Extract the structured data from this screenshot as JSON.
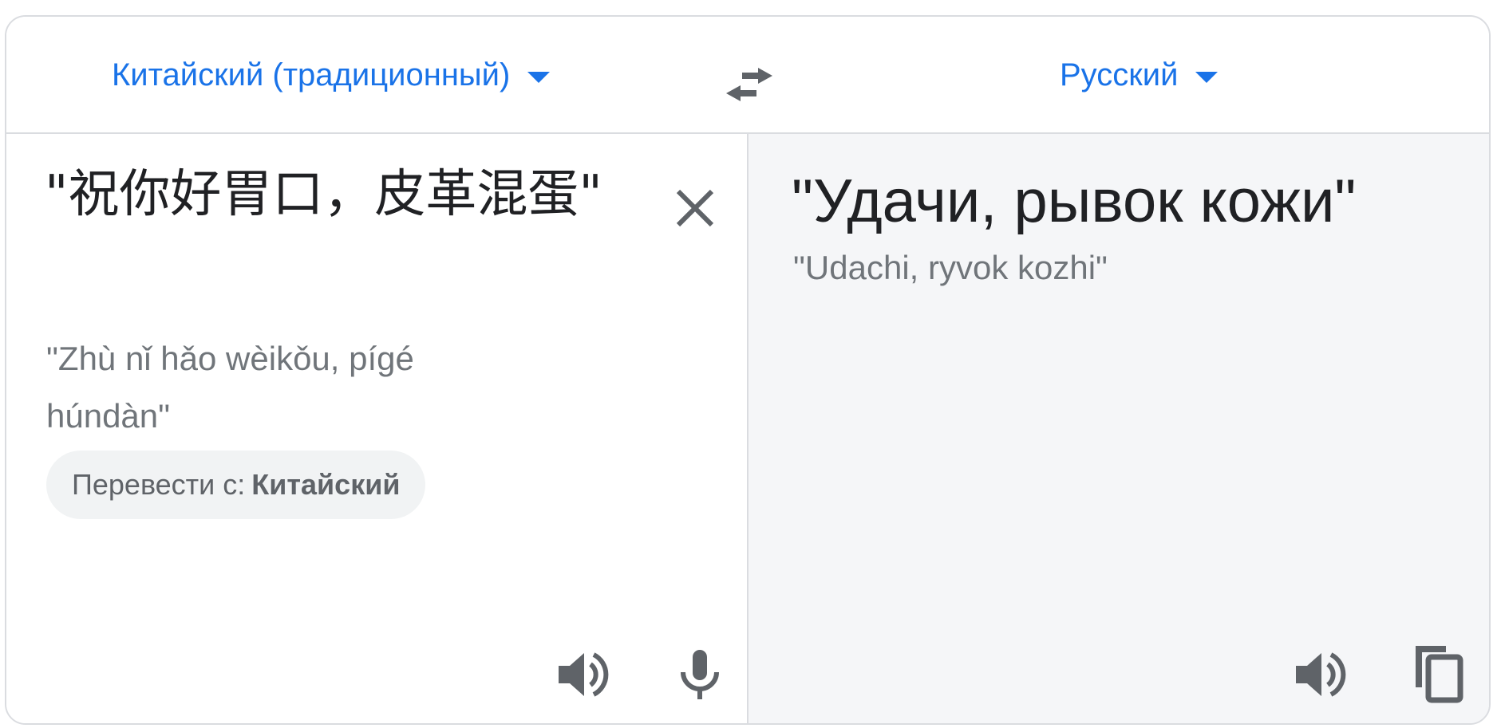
{
  "source_language": {
    "label": "Китайский (традиционный)",
    "icon": "dropdown-caret-icon"
  },
  "target_language": {
    "label": "Русский",
    "icon": "dropdown-caret-icon"
  },
  "swap_button": {
    "icon": "swap-arrows-icon"
  },
  "source": {
    "text": "\"祝你好胃口，皮革混蛋\"",
    "transliteration": "\"Zhù nǐ hǎo wèikǒu, pígé húndàn\"",
    "clear_icon": "close-icon",
    "listen_icon": "speaker-icon",
    "mic_icon": "microphone-icon"
  },
  "detect_chip": {
    "prefix": "Перевести с:",
    "language": "Китайский"
  },
  "target": {
    "text": "\"Удачи, рывок кожи\"",
    "transliteration": "\"Udachi, ryvok kozhi\"",
    "listen_icon": "speaker-icon",
    "copy_icon": "copy-icon"
  },
  "colors": {
    "accent": "#1a73e8",
    "text_primary": "#202124",
    "text_secondary": "#70757a",
    "icon": "#5f6368",
    "border": "#dadce0",
    "target_panel_bg": "#f5f6f8",
    "chip_bg": "#f1f3f4"
  }
}
